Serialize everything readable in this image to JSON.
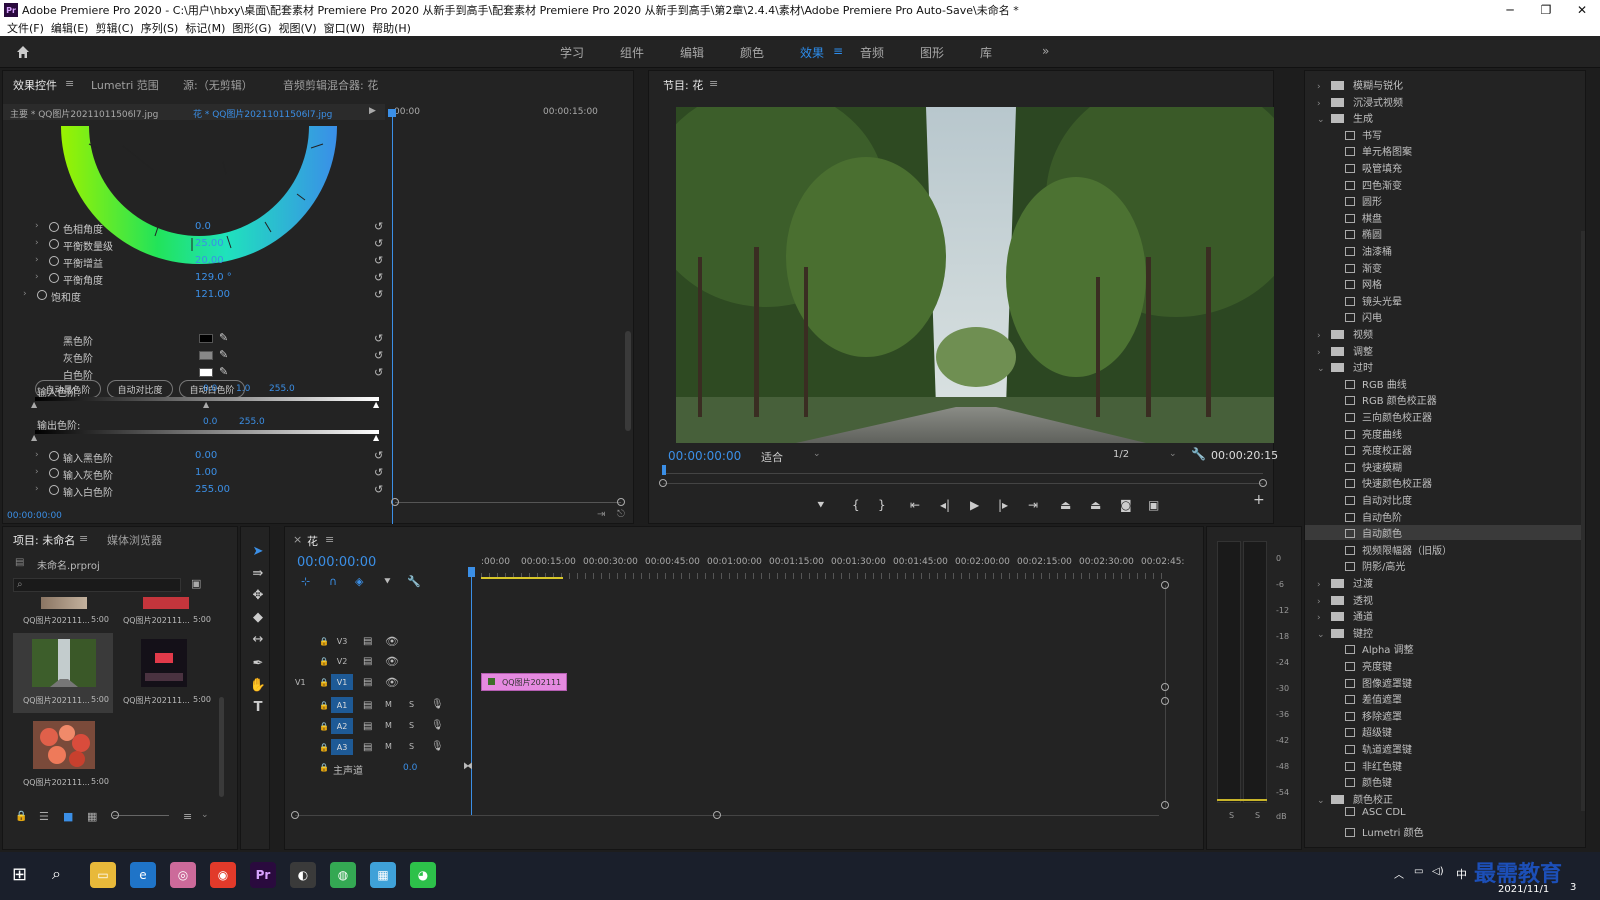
{
  "window": {
    "title": "Adobe Premiere Pro 2020 - C:\\用户\\hbxy\\桌面\\配套素材 Premiere Pro 2020 从新手到高手\\配套素材 Premiere Pro 2020 从新手到高手\\第2章\\2.4.4\\素材\\Adobe Premiere Pro Auto-Save\\未命名 *",
    "app_badge": "Pr",
    "minimize": "─",
    "restore": "❐",
    "close": "✕"
  },
  "menu": [
    "文件(F)",
    "编辑(E)",
    "剪辑(C)",
    "序列(S)",
    "标记(M)",
    "图形(G)",
    "视图(V)",
    "窗口(W)",
    "帮助(H)"
  ],
  "workspaces": {
    "items": [
      "学习",
      "组件",
      "编辑",
      "颜色",
      "效果",
      "音频",
      "图形",
      "库"
    ],
    "active": "效果",
    "more": "»",
    "menu_icon": "≡"
  },
  "effect_controls": {
    "tabs": [
      "效果控件",
      "Lumetri 范围",
      "源:（无剪辑）",
      "音频剪辑混合器: 花"
    ],
    "tab_menu": "≡",
    "master_clip": "主要 * QQ图片20211011506l7.jpg",
    "clip": "花 * QQ图片20211011506l7.jpg",
    "ruler_start": ":00:00",
    "ruler_mid": "00:00:15:00",
    "properties": [
      {
        "label": "色相角度",
        "value": "0.0"
      },
      {
        "label": "平衡数量级",
        "value": "25.00"
      },
      {
        "label": "平衡增益",
        "value": "20.00"
      },
      {
        "label": "平衡角度",
        "value": "129.0 °"
      },
      {
        "label": "饱和度",
        "value": "121.00"
      }
    ],
    "auto_buttons": [
      "自动黑色阶",
      "自动对比度",
      "自动白色阶"
    ],
    "levels": [
      "黑色阶",
      "灰色阶",
      "白色阶"
    ],
    "input_levels_label": "输入色阶:",
    "input_levels_values": [
      "0.0",
      "1.0",
      "255.0"
    ],
    "output_levels_label": "输出色阶:",
    "output_levels_values": [
      "0.0",
      "255.0"
    ],
    "bottom_properties": [
      {
        "label": "输入黑色阶",
        "value": "0.00"
      },
      {
        "label": "输入灰色阶",
        "value": "1.00"
      },
      {
        "label": "输入白色阶",
        "value": "255.00"
      }
    ],
    "timecode": "00:00:00:00",
    "reset_glyph": "↺"
  },
  "program_monitor": {
    "title": "节目: 花",
    "menu": "≡",
    "timecode": "00:00:00:00",
    "fit": "适合",
    "quality": "1/2",
    "duration": "00:00:20:15",
    "add": "+"
  },
  "project": {
    "tabs": [
      "项目: 未命名",
      "媒体浏览器"
    ],
    "tab_menu": "≡",
    "file": "未命名.prproj",
    "search_placeholder": "",
    "items": [
      {
        "name": "QQ图片202111...",
        "duration": "5:00"
      },
      {
        "name": "QQ图片202111...",
        "duration": "5:00"
      },
      {
        "name": "QQ图片202111...",
        "duration": "5:00"
      },
      {
        "name": "QQ图片202111...",
        "duration": "5:00"
      },
      {
        "name": "QQ图片202111...",
        "duration": "5:00"
      }
    ]
  },
  "timeline": {
    "close": "×",
    "name": "花",
    "menu": "≡",
    "timecode": "00:00:00:00",
    "ruler": [
      ":00:00",
      "00:00:15:00",
      "00:00:30:00",
      "00:00:45:00",
      "00:01:00:00",
      "00:01:15:00",
      "00:01:30:00",
      "00:01:45:00",
      "00:02:00:00",
      "00:02:15:00",
      "00:02:30:00",
      "00:02:45:"
    ],
    "video_tracks": [
      "V3",
      "V2",
      "V1"
    ],
    "source_patch": "V1",
    "audio_tracks": [
      "A1",
      "A2",
      "A3"
    ],
    "mute": "M",
    "solo": "S",
    "master": "主声道",
    "master_value": "0.0",
    "clip": "QQ图片202111"
  },
  "meter": {
    "scale": [
      "0",
      "-6",
      "-12",
      "-18",
      "-24",
      "-30",
      "-36",
      "-42",
      "-48",
      "-54",
      "dB"
    ],
    "solo_buttons": [
      "S",
      "S"
    ]
  },
  "effects": {
    "rows": [
      {
        "type": "folder",
        "open": false,
        "label": "模糊与锐化"
      },
      {
        "type": "folder",
        "open": false,
        "label": "沉浸式视频"
      },
      {
        "type": "folder",
        "open": true,
        "label": "生成"
      },
      {
        "type": "item",
        "label": "书写"
      },
      {
        "type": "item",
        "label": "单元格图案"
      },
      {
        "type": "item",
        "label": "吸管填充"
      },
      {
        "type": "item",
        "label": "四色渐变"
      },
      {
        "type": "item",
        "label": "圆形"
      },
      {
        "type": "item",
        "label": "棋盘"
      },
      {
        "type": "item",
        "label": "椭圆"
      },
      {
        "type": "item",
        "label": "油漆桶"
      },
      {
        "type": "item",
        "label": "渐变"
      },
      {
        "type": "item",
        "label": "网格"
      },
      {
        "type": "item",
        "label": "镜头光晕"
      },
      {
        "type": "item",
        "label": "闪电"
      },
      {
        "type": "folder",
        "open": false,
        "label": "视频"
      },
      {
        "type": "folder",
        "open": false,
        "label": "调整"
      },
      {
        "type": "folder",
        "open": true,
        "label": "过时"
      },
      {
        "type": "item",
        "label": "RGB 曲线"
      },
      {
        "type": "item",
        "label": "RGB 颜色校正器"
      },
      {
        "type": "item",
        "label": "三向颜色校正器"
      },
      {
        "type": "item",
        "label": "亮度曲线"
      },
      {
        "type": "item",
        "label": "亮度校正器"
      },
      {
        "type": "item",
        "label": "快速模糊"
      },
      {
        "type": "item",
        "label": "快速颜色校正器"
      },
      {
        "type": "item",
        "label": "自动对比度"
      },
      {
        "type": "item",
        "label": "自动色阶"
      },
      {
        "type": "item",
        "label": "自动颜色",
        "selected": true
      },
      {
        "type": "item",
        "label": "视频限幅器（旧版）"
      },
      {
        "type": "item",
        "label": "阴影/高光"
      },
      {
        "type": "folder",
        "open": false,
        "label": "过渡"
      },
      {
        "type": "folder",
        "open": false,
        "label": "透视"
      },
      {
        "type": "folder",
        "open": false,
        "label": "通道"
      },
      {
        "type": "folder",
        "open": true,
        "label": "键控"
      },
      {
        "type": "item",
        "label": "Alpha 调整"
      },
      {
        "type": "item",
        "label": "亮度键"
      },
      {
        "type": "item",
        "label": "图像遮罩键"
      },
      {
        "type": "item",
        "label": "差值遮罩"
      },
      {
        "type": "item",
        "label": "移除遮罩"
      },
      {
        "type": "item",
        "label": "超级键"
      },
      {
        "type": "item",
        "label": "轨道遮罩键"
      },
      {
        "type": "item",
        "label": "非红色键"
      },
      {
        "type": "item",
        "label": "颜色键"
      },
      {
        "type": "folder",
        "open": true,
        "label": "颜色校正"
      },
      {
        "type": "item",
        "label": "ASC CDL"
      },
      {
        "type": "item",
        "label": "Lumetri 颜色"
      }
    ]
  },
  "taskbar": {
    "date": "2021/11/1",
    "watermark": "最需教育",
    "ime": "中",
    "notify": "3"
  },
  "colors": {
    "accent": "#2d8ceb",
    "panel": "#232323",
    "clip": "#e58ae0",
    "selected_row": "#3a3a3a"
  }
}
